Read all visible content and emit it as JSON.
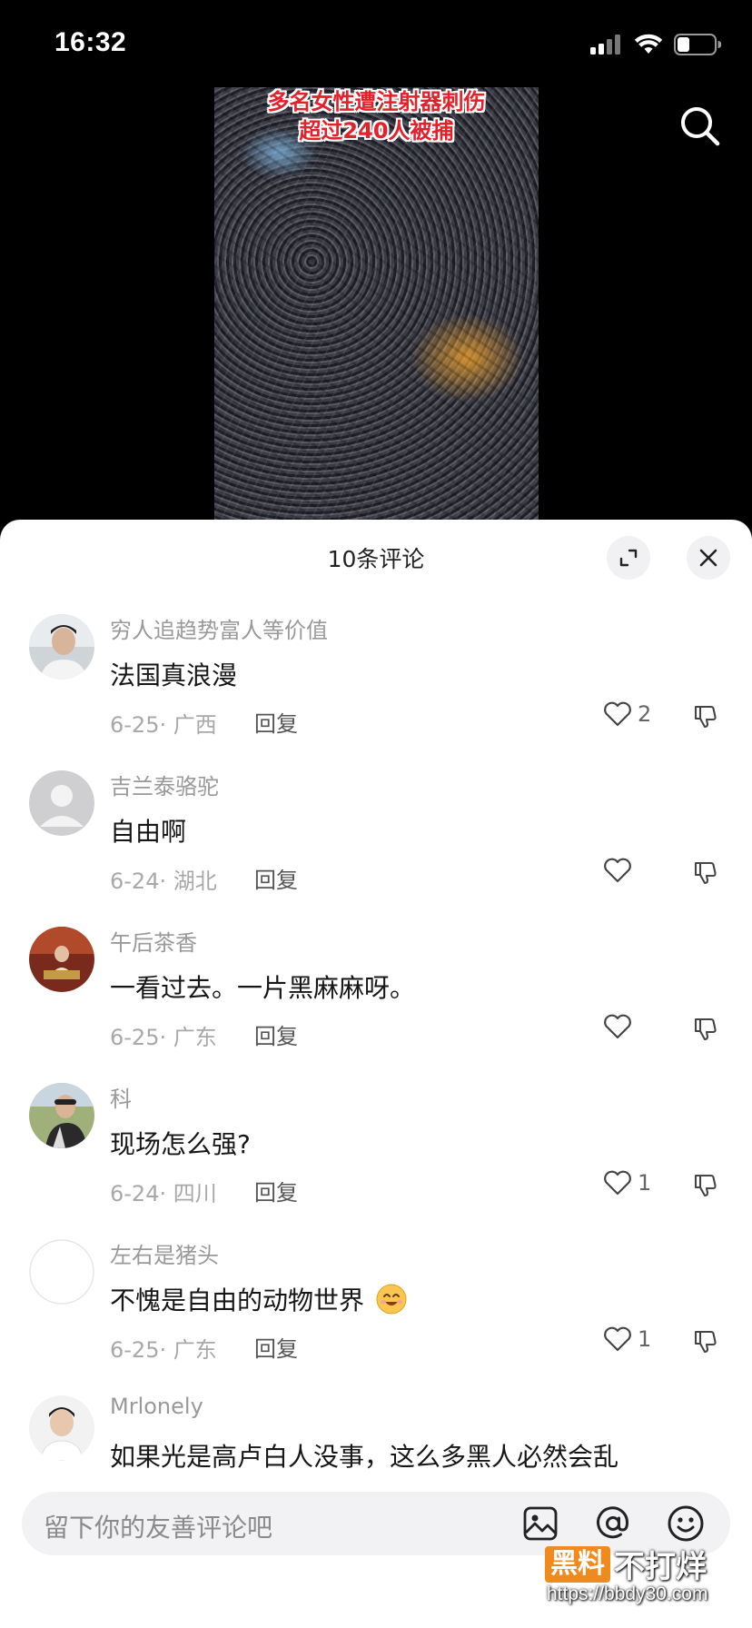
{
  "status_bar": {
    "time": "16:32"
  },
  "video": {
    "caption_line1": "多名女性遭注射器刺伤",
    "caption_line2": "超过240人被捕"
  },
  "sheet": {
    "title": "10条评论"
  },
  "comments": [
    {
      "username": "穷人追趋势富人等价值",
      "text": "法国真浪漫",
      "date_location": "6-25· 广西",
      "reply_label": "回复",
      "likes": "2"
    },
    {
      "username": "吉兰泰骆驼",
      "text": "自由啊",
      "date_location": "6-24· 湖北",
      "reply_label": "回复",
      "likes": ""
    },
    {
      "username": "午后茶香",
      "text": "一看过去。一片黑麻麻呀。",
      "date_location": "6-25· 广东",
      "reply_label": "回复",
      "likes": ""
    },
    {
      "username": "科",
      "text": "现场怎么强?",
      "date_location": "6-24· 四川",
      "reply_label": "回复",
      "likes": "1"
    },
    {
      "username": "左右是猪头",
      "text": "不愧是自由的动物世界",
      "date_location": "6-25· 广东",
      "reply_label": "回复",
      "likes": "1"
    },
    {
      "username": "Mrlonely",
      "text": "如果光是高卢白人没事，这么多黑人必然会乱"
    }
  ],
  "input": {
    "placeholder": "留下你的友善评论吧"
  },
  "watermark": {
    "badge": "黑料",
    "text": "不打烊",
    "url": "https://bbdy30.com"
  },
  "colors": {
    "accent_caption": "#e5202a",
    "watermark_orange": "#f08a1c"
  }
}
